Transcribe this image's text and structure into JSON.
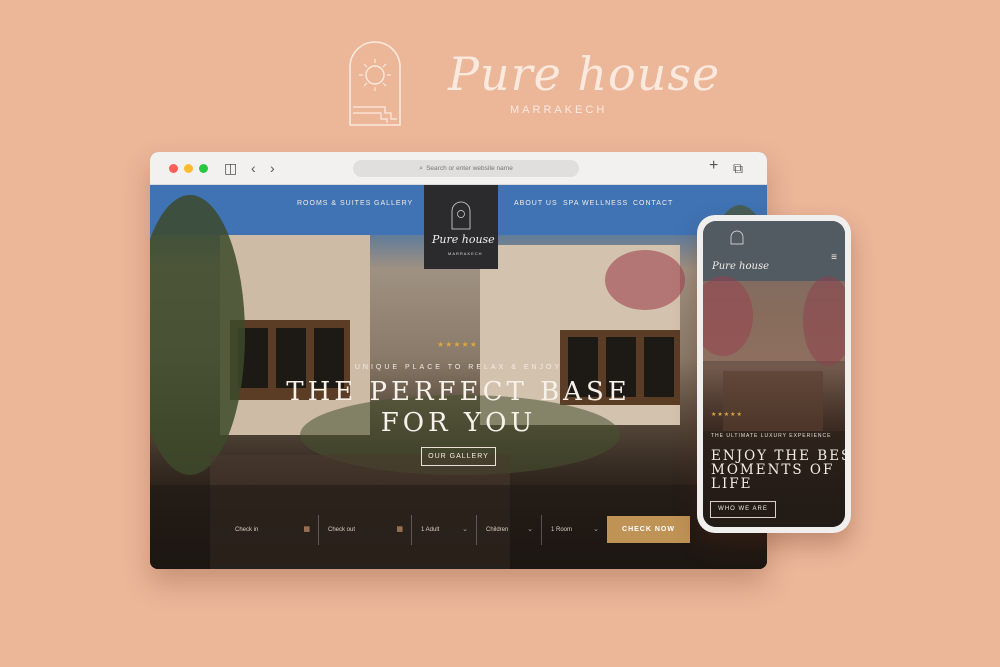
{
  "brand": {
    "name": "Pure house",
    "subtitle": "MARRAKECH"
  },
  "browser": {
    "url_placeholder": "Search or enter website name"
  },
  "site": {
    "nav_left": [
      "ROOMS & SUITES",
      "GALLERY"
    ],
    "nav_right": [
      "ABOUT US",
      "SPA WELLNESS",
      "CONTACT"
    ],
    "logo_name": "Pure house",
    "logo_sub": "MARRAKECH",
    "stars": "★★★★★",
    "tagline": "UNIQUE PLACE TO RELAX & ENJOY",
    "title_line1": "THE PERFECT BASE",
    "title_line2": "FOR YOU",
    "gallery_button": "OUR GALLERY",
    "booking": {
      "check_in": "Check in",
      "check_out": "Check out",
      "adults": "1 Adult",
      "children": "Children",
      "rooms": "1 Room",
      "submit": "CHECK NOW"
    }
  },
  "mobile": {
    "logo_name": "Pure house",
    "stars": "★★★★★",
    "tagline": "THE ULTIMATE LUXURY EXPERIENCE",
    "title_line1": "ENJOY THE BEST",
    "title_line2": "MOMENTS OF",
    "title_line3": "LIFE",
    "button": "WHO WE ARE"
  },
  "colors": {
    "background": "#ecb699",
    "accent_gold": "#bf9356",
    "star_gold": "#d9a741"
  }
}
